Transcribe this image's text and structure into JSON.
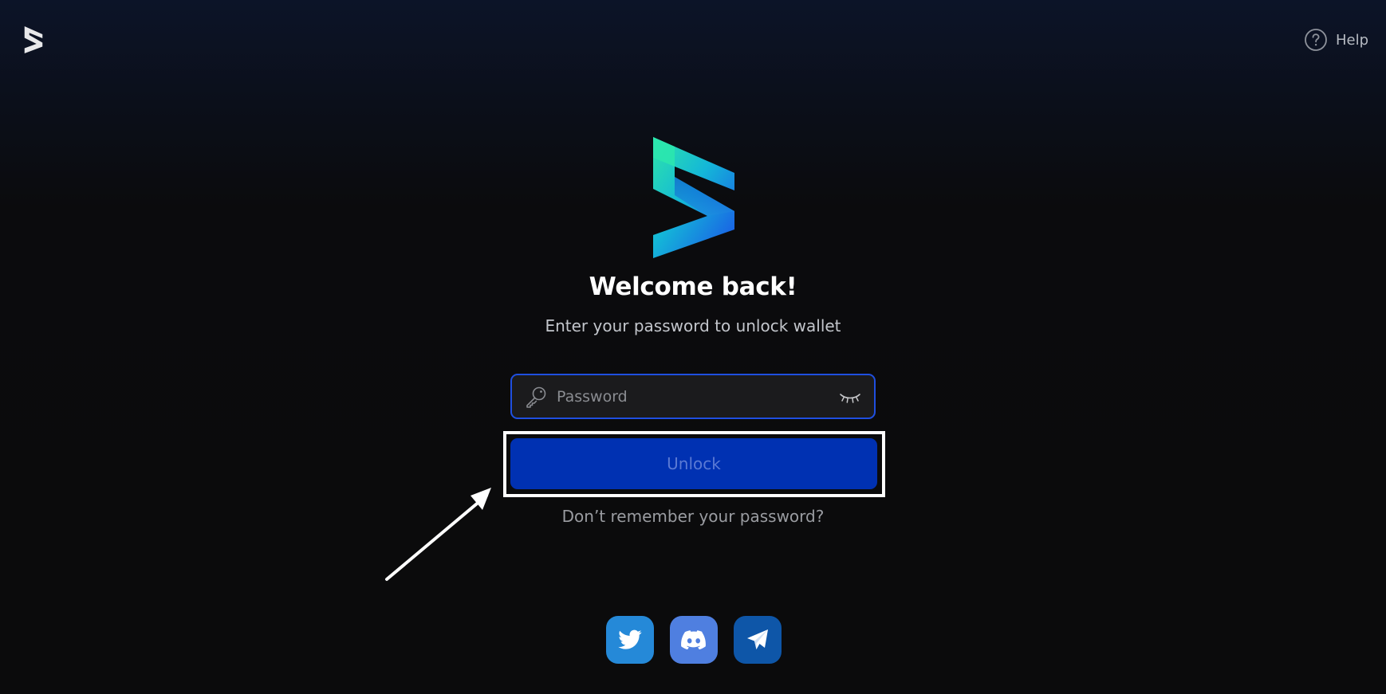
{
  "header": {
    "help_label": "Help"
  },
  "login": {
    "title": "Welcome back!",
    "subtitle": "Enter your password to unlock wallet",
    "password_placeholder": "Password",
    "unlock_label": "Unlock",
    "forgot_label": "Don’t remember your password?"
  },
  "icons": {
    "topbar_logo": "wallet-logo-icon",
    "help": "question-circle-icon",
    "brand_logo": "wallet-logo-icon",
    "password_key": "key-icon",
    "password_toggle": "eye-closed-icon",
    "annotation": "arrow-icon",
    "social": [
      "twitter-icon",
      "discord-icon",
      "telegram-icon"
    ]
  },
  "colors": {
    "accent": "#1f4fe0",
    "unlock_button": "#0031b2",
    "unlock_text": "#5b7ad4",
    "twitter": "#2589d8",
    "discord": "#4f7fe0",
    "telegram": "#0e56a8",
    "logo_gradient_start": "#2ee6a8",
    "logo_gradient_end": "#1b4fe8"
  }
}
